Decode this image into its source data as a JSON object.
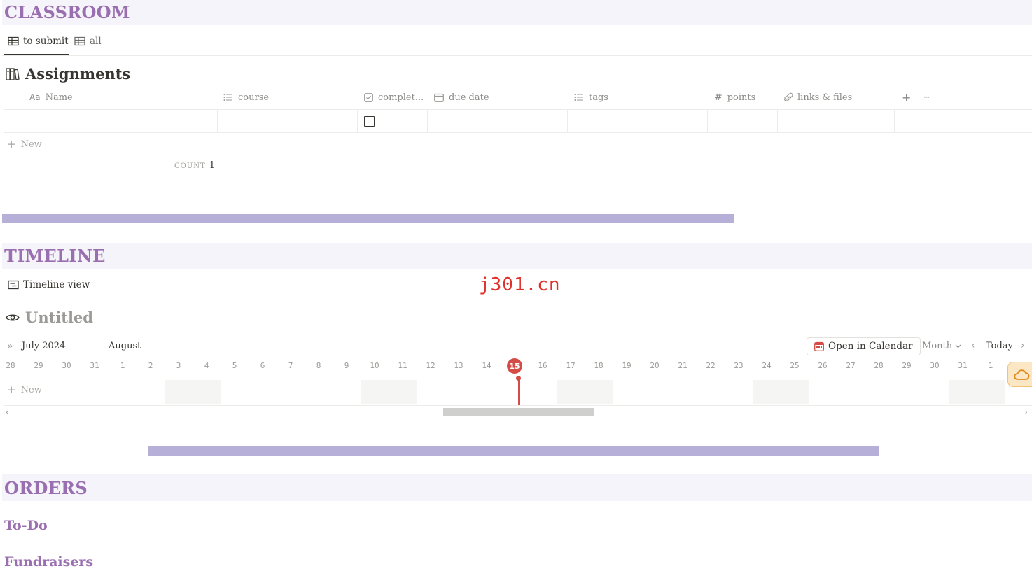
{
  "classroom": {
    "title": "CLASSROOM",
    "tabs": [
      {
        "label": "to submit",
        "icon": "table-icon",
        "active": true
      },
      {
        "label": "all",
        "icon": "table-icon",
        "active": false
      }
    ],
    "database": {
      "title": "Assignments",
      "icon": "books-icon",
      "columns": [
        {
          "label": "Name",
          "icon": "text-property-icon"
        },
        {
          "label": "course",
          "icon": "list-icon"
        },
        {
          "label": "complet...",
          "icon": "checkbox-icon"
        },
        {
          "label": "due date",
          "icon": "calendar-icon"
        },
        {
          "label": "tags",
          "icon": "list-icon"
        },
        {
          "label": "points",
          "icon": "hash-icon"
        },
        {
          "label": "links & files",
          "icon": "paperclip-icon"
        }
      ],
      "name_prefix": "Aa",
      "add_column": "+",
      "more": "···",
      "new_label": "New",
      "count_label": "COUNT",
      "count_value": "1"
    }
  },
  "timeline": {
    "title": "TIMELINE",
    "view_tab": "Timeline view",
    "watermark": "j301.cn",
    "database": {
      "title": "Untitled",
      "icon": "eye-icon",
      "month_label": "July 2024",
      "next_month": "August",
      "open_calendar": "Open in Calendar",
      "range_select": "Month",
      "today_button": "Today",
      "today_date": "15",
      "dates": [
        "28",
        "29",
        "30",
        "31",
        "1",
        "2",
        "3",
        "4",
        "5",
        "6",
        "7",
        "8",
        "9",
        "10",
        "11",
        "12",
        "13",
        "14",
        "15",
        "16",
        "17",
        "18",
        "19",
        "20",
        "21",
        "22",
        "23",
        "24",
        "25",
        "26",
        "27",
        "28",
        "29",
        "30",
        "31",
        "1"
      ],
      "new_label": "New",
      "scroll_left": "‹",
      "scroll_right": "›"
    }
  },
  "orders": {
    "title": "ORDERS",
    "subsections": [
      "To-Do",
      "Fundraisers"
    ]
  },
  "colors": {
    "section_title": "#9a6fb0",
    "section_bar": "#f5f4fa",
    "strip": "#b6b0d8",
    "today": "#d44c47",
    "watermark": "#e0302a"
  }
}
